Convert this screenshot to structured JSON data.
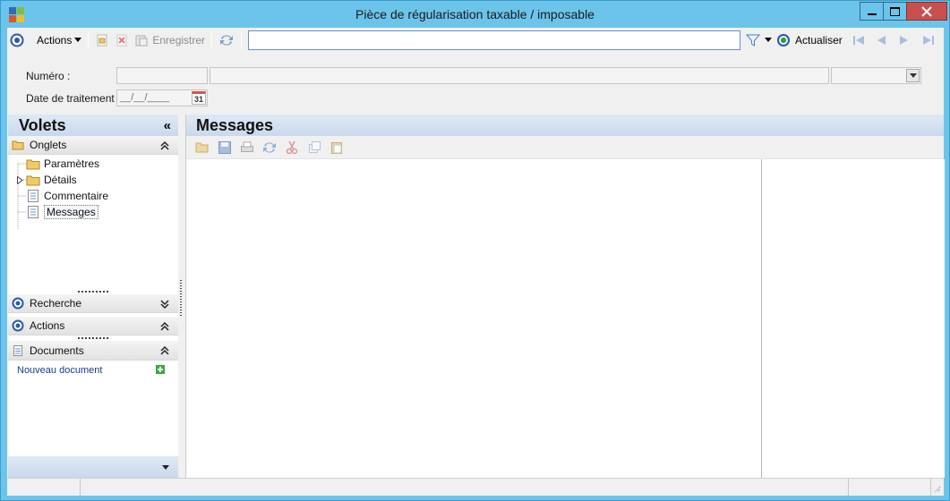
{
  "window": {
    "title": "Pièce de régularisation taxable / imposable"
  },
  "toolbar": {
    "actions_label": "Actions",
    "save_label": "Enregistrer",
    "search_value": "",
    "refresh_label": "Actualiser"
  },
  "form": {
    "numero_label": "Numéro :",
    "date_label": "Date de traitement :",
    "date_placeholder": "__/__/____",
    "calendar_day": "31"
  },
  "volets": {
    "title": "Volets",
    "collapse_glyph": "«",
    "onglets_label": "Onglets",
    "tree": [
      {
        "label": "Paramètres",
        "icon": "folder-icon"
      },
      {
        "label": "Détails",
        "icon": "folder-icon"
      },
      {
        "label": "Commentaire",
        "icon": "document-icon"
      },
      {
        "label": "Messages",
        "icon": "document-icon"
      }
    ],
    "recherche_label": "Recherche",
    "actions_label": "Actions",
    "documents_label": "Documents",
    "new_document_label": "Nouveau document"
  },
  "main": {
    "title": "Messages"
  },
  "colors": {
    "window_frame": "#6cc4ea",
    "panel_header": "#c9d9ec",
    "close_button": "#c7504f"
  }
}
